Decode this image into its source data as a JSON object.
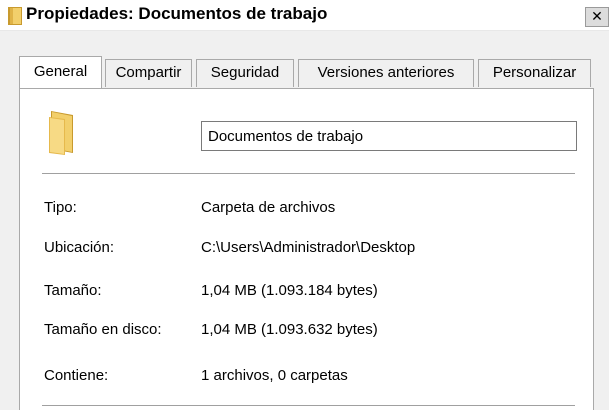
{
  "window": {
    "title": "Propiedades: Documentos de trabajo",
    "close_label": "✕"
  },
  "tabs": [
    {
      "label": "General",
      "active": true
    },
    {
      "label": "Compartir",
      "active": false
    },
    {
      "label": "Seguridad",
      "active": false
    },
    {
      "label": "Versiones anteriores",
      "active": false
    },
    {
      "label": "Personalizar",
      "active": false
    }
  ],
  "general": {
    "folder_name": "Documentos de trabajo",
    "properties": [
      {
        "label": "Tipo:",
        "value": "Carpeta de archivos"
      },
      {
        "label": "Ubicación:",
        "value": "C:\\Users\\Administrador\\Desktop"
      },
      {
        "label": "Tamaño:",
        "value": "1,04 MB (1.093.184 bytes)"
      },
      {
        "label": "Tamaño en disco:",
        "value": "1,04 MB (1.093.632 bytes)"
      },
      {
        "label": "Contiene:",
        "value": "1 archivos, 0 carpetas"
      }
    ]
  },
  "icons": {
    "title_icon": "folder-icon",
    "main_icon": "folder-icon",
    "close": "close-icon"
  },
  "colors": {
    "folder": "#f2cf6b",
    "folder_dark": "#c89a2e"
  }
}
